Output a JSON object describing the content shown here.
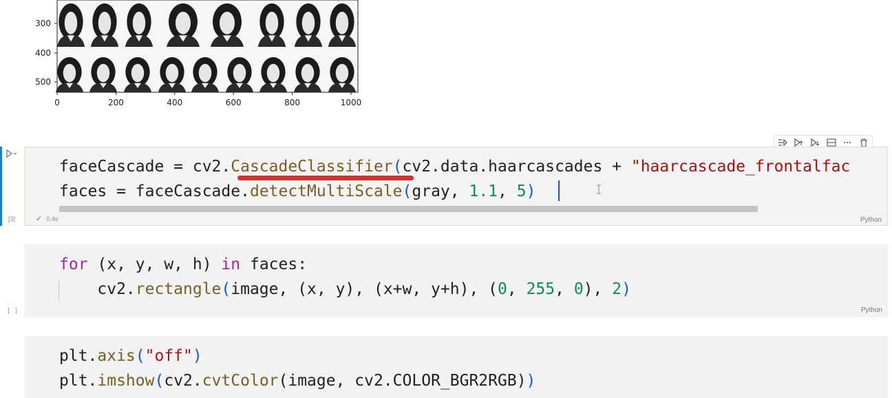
{
  "plot": {
    "yticks": [
      "300",
      "400",
      "500"
    ],
    "xticks": [
      "0",
      "200",
      "400",
      "600",
      "800",
      "1000"
    ]
  },
  "toolbar": {
    "icons": [
      "run-by-line-icon",
      "execute-above-icon",
      "execute-below-icon",
      "split-cell-icon",
      "more-icon",
      "delete-icon"
    ]
  },
  "cells": [
    {
      "exec_count": "[3]",
      "status_time": "0.4s",
      "language": "Python",
      "lines": [
        [
          {
            "t": "faceCascade = cv2.",
            "c": "k-plain"
          },
          {
            "t": "CascadeClassifier",
            "c": "k-fn"
          },
          {
            "t": "(",
            "c": "k-par"
          },
          {
            "t": "cv2.data.haarcascades + ",
            "c": "k-plain"
          },
          {
            "t": "\"haarcascade_frontalfac",
            "c": "k-str"
          }
        ],
        [
          {
            "t": "faces = faceCascade.",
            "c": "k-plain"
          },
          {
            "t": "detectMultiScale",
            "c": "k-fn"
          },
          {
            "t": "(",
            "c": "k-par"
          },
          {
            "t": "gray, ",
            "c": "k-plain"
          },
          {
            "t": "1.1",
            "c": "k-num"
          },
          {
            "t": ", ",
            "c": "k-plain"
          },
          {
            "t": "5",
            "c": "k-num"
          },
          {
            "t": ")",
            "c": "k-par"
          }
        ]
      ]
    },
    {
      "exec_count": "[ ]",
      "language": "Python",
      "lines": [
        [
          {
            "t": "for",
            "c": "k-kw"
          },
          {
            "t": " (x, y, w, h) ",
            "c": "k-plain"
          },
          {
            "t": "in",
            "c": "k-kw"
          },
          {
            "t": " faces:",
            "c": "k-plain"
          }
        ],
        [
          {
            "t": "    cv2.",
            "c": "k-plain"
          },
          {
            "t": "rectangle",
            "c": "k-fn"
          },
          {
            "t": "(",
            "c": "k-par"
          },
          {
            "t": "image, (x, y), (x+w, y+h), (",
            "c": "k-plain"
          },
          {
            "t": "0",
            "c": "k-num"
          },
          {
            "t": ", ",
            "c": "k-plain"
          },
          {
            "t": "255",
            "c": "k-num"
          },
          {
            "t": ", ",
            "c": "k-plain"
          },
          {
            "t": "0",
            "c": "k-num"
          },
          {
            "t": "), ",
            "c": "k-plain"
          },
          {
            "t": "2",
            "c": "k-num"
          },
          {
            "t": ")",
            "c": "k-par"
          }
        ]
      ]
    },
    {
      "lines": [
        [
          {
            "t": "plt.",
            "c": "k-plain"
          },
          {
            "t": "axis",
            "c": "k-fn"
          },
          {
            "t": "(",
            "c": "k-par"
          },
          {
            "t": "\"off\"",
            "c": "k-str"
          },
          {
            "t": ")",
            "c": "k-par"
          }
        ],
        [
          {
            "t": "plt.",
            "c": "k-plain"
          },
          {
            "t": "imshow",
            "c": "k-fn"
          },
          {
            "t": "(",
            "c": "k-par"
          },
          {
            "t": "cv2.",
            "c": "k-plain"
          },
          {
            "t": "cvtColor",
            "c": "k-fn"
          },
          {
            "t": "(image, cv2.COLOR_BGR2RGB)",
            "c": "k-plain"
          },
          {
            "t": ")",
            "c": "k-par"
          }
        ]
      ]
    }
  ]
}
